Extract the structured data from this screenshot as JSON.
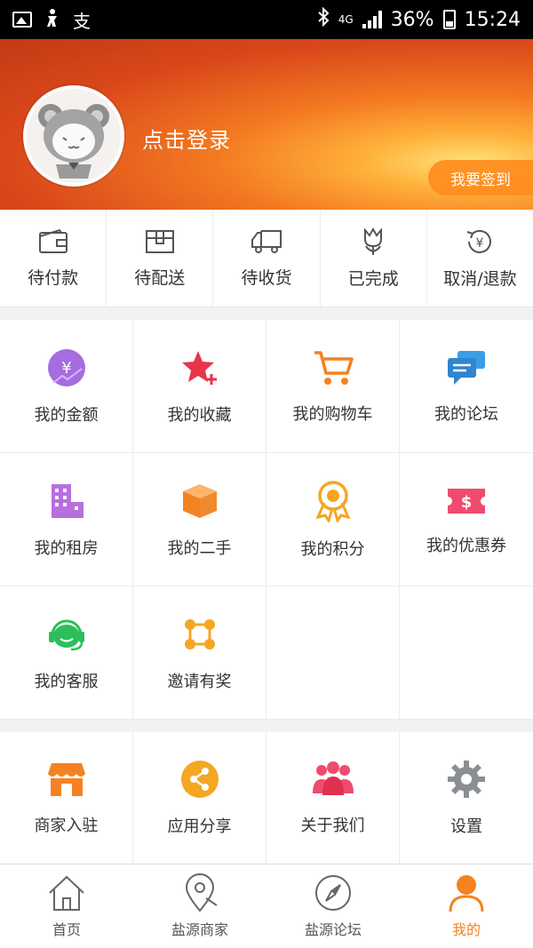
{
  "status_bar": {
    "left_icons": [
      "image-icon",
      "figure-icon",
      "pay-icon"
    ],
    "pay_glyph": "支",
    "bluetooth": "bluetooth-icon",
    "network": "4G",
    "battery_percent": "36%",
    "time": "15:24"
  },
  "header": {
    "login_text": "点击登录",
    "checkin_label": "我要签到"
  },
  "orders": [
    {
      "label": "待付款",
      "icon": "wallet-icon"
    },
    {
      "label": "待配送",
      "icon": "package-icon"
    },
    {
      "label": "待收货",
      "icon": "truck-icon"
    },
    {
      "label": "已完成",
      "icon": "tulip-icon"
    },
    {
      "label": "取消/退款",
      "icon": "refund-icon"
    }
  ],
  "services": [
    {
      "label": "我的金额",
      "icon": "money-icon",
      "color": "#a56de0"
    },
    {
      "label": "我的收藏",
      "icon": "favorite-star-icon",
      "color": "#e8344b"
    },
    {
      "label": "我的购物车",
      "icon": "cart-icon",
      "color": "#f58220"
    },
    {
      "label": "我的论坛",
      "icon": "chat-icon",
      "color": "#3a9ee6"
    },
    {
      "label": "我的租房",
      "icon": "building-icon",
      "color": "#b76fe0"
    },
    {
      "label": "我的二手",
      "icon": "box-icon",
      "color": "#f58220"
    },
    {
      "label": "我的积分",
      "icon": "medal-icon",
      "color": "#f5a623"
    },
    {
      "label": "我的优惠券",
      "icon": "coupon-icon",
      "color": "#ef4b6e"
    },
    {
      "label": "我的客服",
      "icon": "headset-icon",
      "color": "#2bbf5a"
    },
    {
      "label": "邀请有奖",
      "icon": "invite-icon",
      "color": "#f5a623"
    }
  ],
  "misc": [
    {
      "label": "商家入驻",
      "icon": "store-icon",
      "color": "#f58220"
    },
    {
      "label": "应用分享",
      "icon": "share-icon",
      "color": "#f5a623"
    },
    {
      "label": "关于我们",
      "icon": "group-icon",
      "color": "#ef4b6e"
    },
    {
      "label": "设置",
      "icon": "gear-icon",
      "color": "#8a8f96"
    }
  ],
  "bottom_nav": [
    {
      "label": "首页",
      "icon": "home-icon"
    },
    {
      "label": "盐源商家",
      "icon": "location-icon"
    },
    {
      "label": "盐源论坛",
      "icon": "compass-icon"
    },
    {
      "label": "我的",
      "icon": "user-icon",
      "active": true,
      "active_color": "#f58220"
    }
  ]
}
